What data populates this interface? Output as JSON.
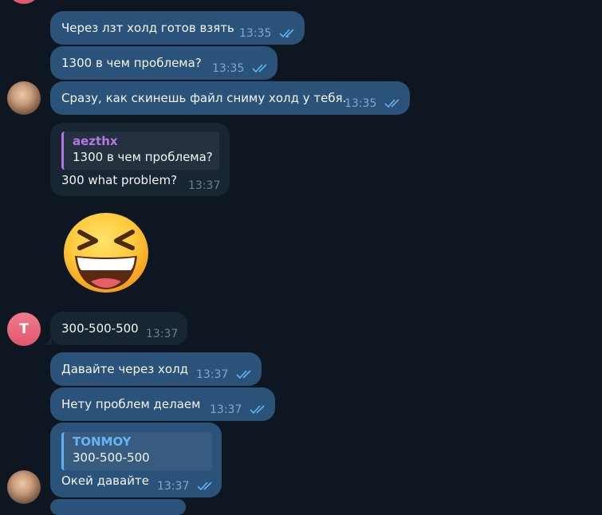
{
  "messages": [
    {
      "id": "m1",
      "text": "Через лзт холд готов взять",
      "time": "13:35"
    },
    {
      "id": "m2",
      "text": "1300 в чем проблема?",
      "time": "13:35"
    },
    {
      "id": "m3",
      "text": "Сразу, как скинешь файл сниму холд у тебя.",
      "time": "13:35"
    },
    {
      "id": "m4",
      "quote_name": "aezthx",
      "quote_text": "1300 в чем проблема?",
      "text": "300 what problem?",
      "time": "13:37"
    },
    {
      "id": "m5",
      "text": "300-500-500",
      "time": "13:37"
    },
    {
      "id": "m6",
      "text": "Давайте через холд",
      "time": "13:37"
    },
    {
      "id": "m7",
      "text": "Нету проблем делаем",
      "time": "13:37"
    },
    {
      "id": "m8",
      "quote_name": "TONMOY",
      "quote_text": "300-500-500",
      "text": "Окей давайте",
      "time": "13:37"
    }
  ],
  "avatars": {
    "letter_avatar": "T"
  },
  "sticker": {
    "name": "grinning-squinting-face-emoji"
  },
  "colors": {
    "background": "#0e1621",
    "outgoing_bubble": "#2b5278",
    "incoming_bubble": "#182533",
    "read_ticks": "#5fb2f4",
    "quote_purple": "#b178e6",
    "quote_blue": "#6ab3f3"
  }
}
